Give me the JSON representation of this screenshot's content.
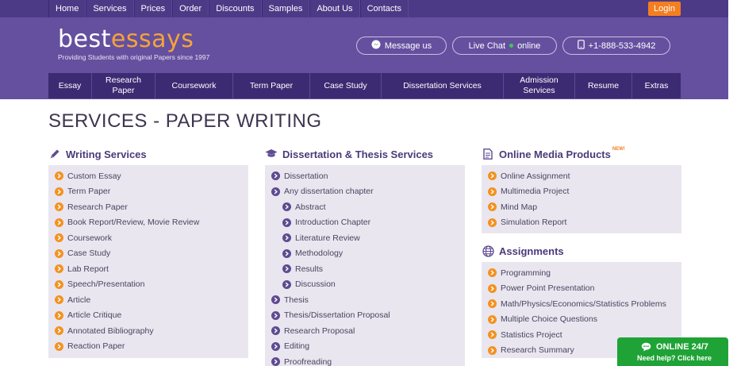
{
  "topnav": [
    "Home",
    "Services",
    "Prices",
    "Order",
    "Discounts",
    "Samples",
    "About Us",
    "Contacts"
  ],
  "login_label": "Login",
  "logo": {
    "part1": "best",
    "part2": "essays",
    "tagline": "Providing Students with original Papers since 1997"
  },
  "contact": {
    "message": "Message us",
    "chat": "Live Chat",
    "chat_status": "online",
    "phone": "+1-888-533-4942"
  },
  "mainnav": [
    "Essay",
    "Research Paper",
    "Coursework",
    "Term Paper",
    "Case Study",
    "Dissertation Services",
    "Admission Services",
    "Resume",
    "Extras"
  ],
  "page_title": "SERVICES - PAPER WRITING",
  "writing": {
    "title": "Writing Services",
    "items": [
      "Custom Essay",
      "Term Paper",
      "Research Paper",
      "Book Report/Review, Movie Review",
      "Coursework",
      "Case Study",
      "Lab Report",
      "Speech/Presentation",
      "Article",
      "Article Critique",
      "Annotated Bibliography",
      "Reaction Paper"
    ]
  },
  "dissertation": {
    "title": "Dissertation & Thesis Services",
    "items": [
      "Dissertation",
      "Any dissertation chapter",
      "Abstract",
      "Introduction Chapter",
      "Literature Review",
      "Methodology",
      "Results",
      "Discussion",
      "Thesis",
      "Thesis/Dissertation Proposal",
      "Research Proposal",
      "Editing",
      "Proofreading"
    ]
  },
  "media": {
    "title": "Online Media Products",
    "badge": "NEW!",
    "items": [
      "Online Assignment",
      "Multimedia Project",
      "Mind Map",
      "Simulation Report"
    ]
  },
  "assignments": {
    "title": "Assignments",
    "items": [
      "Programming",
      "Power Point Presentation",
      "Math/Physics/Economics/Statistics Problems",
      "Multiple Choice Questions",
      "Statistics Project",
      "Research Summary"
    ]
  },
  "online_badge": {
    "line1": "ONLINE 24/7",
    "line2": "Need help? Click here"
  },
  "colors": {
    "header": "#65509f",
    "topbar": "#4d3a86",
    "nav": "#3c2b73",
    "accent": "#f47e20",
    "online": "#1fa336"
  }
}
